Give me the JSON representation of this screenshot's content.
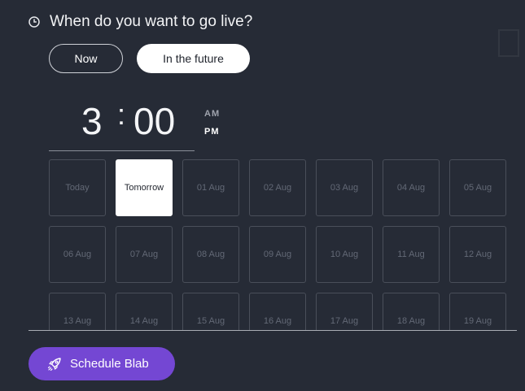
{
  "header": {
    "icon": "clock-icon",
    "title": "When do you want to go live?"
  },
  "mode": {
    "now_label": "Now",
    "future_label": "In the future",
    "selected": "In the future"
  },
  "time": {
    "hour": "3",
    "separator": ":",
    "minutes": "00",
    "am_label": "AM",
    "pm_label": "PM",
    "selected_period": "PM"
  },
  "days": [
    "Today",
    "Tomorrow",
    "01 Aug",
    "02 Aug",
    "03 Aug",
    "04 Aug",
    "05 Aug",
    "06 Aug",
    "07 Aug",
    "08 Aug",
    "09 Aug",
    "10 Aug",
    "11 Aug",
    "12 Aug",
    "13 Aug",
    "14 Aug",
    "15 Aug",
    "16 Aug",
    "17 Aug",
    "18 Aug",
    "19 Aug"
  ],
  "selected_day": "Tomorrow",
  "action": {
    "icon": "rocket-icon",
    "label": "Schedule Blab"
  },
  "colors": {
    "background": "#262b36",
    "accent": "#7447d3",
    "selected": "#ffffff"
  }
}
